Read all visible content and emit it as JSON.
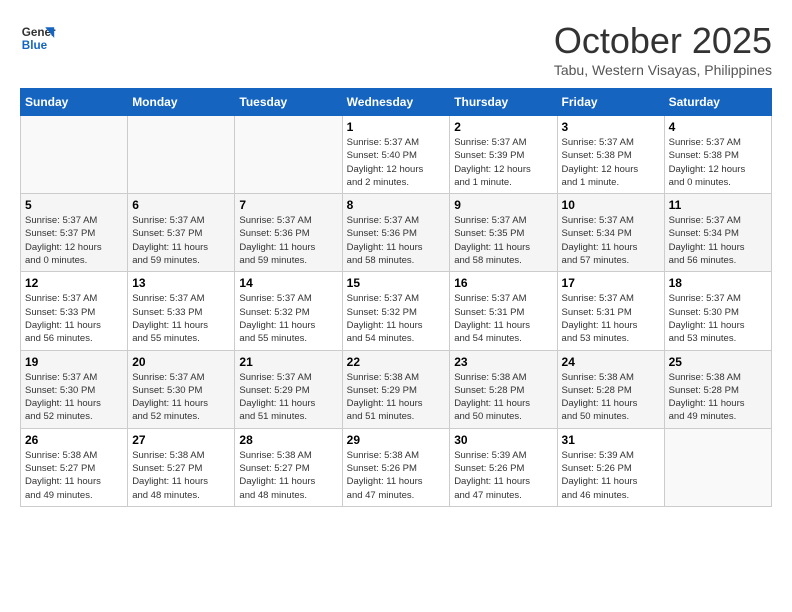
{
  "header": {
    "logo_line1": "General",
    "logo_line2": "Blue",
    "month": "October 2025",
    "location": "Tabu, Western Visayas, Philippines"
  },
  "days_of_week": [
    "Sunday",
    "Monday",
    "Tuesday",
    "Wednesday",
    "Thursday",
    "Friday",
    "Saturday"
  ],
  "weeks": [
    [
      {
        "day": "",
        "info": ""
      },
      {
        "day": "",
        "info": ""
      },
      {
        "day": "",
        "info": ""
      },
      {
        "day": "1",
        "info": "Sunrise: 5:37 AM\nSunset: 5:40 PM\nDaylight: 12 hours\nand 2 minutes."
      },
      {
        "day": "2",
        "info": "Sunrise: 5:37 AM\nSunset: 5:39 PM\nDaylight: 12 hours\nand 1 minute."
      },
      {
        "day": "3",
        "info": "Sunrise: 5:37 AM\nSunset: 5:38 PM\nDaylight: 12 hours\nand 1 minute."
      },
      {
        "day": "4",
        "info": "Sunrise: 5:37 AM\nSunset: 5:38 PM\nDaylight: 12 hours\nand 0 minutes."
      }
    ],
    [
      {
        "day": "5",
        "info": "Sunrise: 5:37 AM\nSunset: 5:37 PM\nDaylight: 12 hours\nand 0 minutes."
      },
      {
        "day": "6",
        "info": "Sunrise: 5:37 AM\nSunset: 5:37 PM\nDaylight: 11 hours\nand 59 minutes."
      },
      {
        "day": "7",
        "info": "Sunrise: 5:37 AM\nSunset: 5:36 PM\nDaylight: 11 hours\nand 59 minutes."
      },
      {
        "day": "8",
        "info": "Sunrise: 5:37 AM\nSunset: 5:36 PM\nDaylight: 11 hours\nand 58 minutes."
      },
      {
        "day": "9",
        "info": "Sunrise: 5:37 AM\nSunset: 5:35 PM\nDaylight: 11 hours\nand 58 minutes."
      },
      {
        "day": "10",
        "info": "Sunrise: 5:37 AM\nSunset: 5:34 PM\nDaylight: 11 hours\nand 57 minutes."
      },
      {
        "day": "11",
        "info": "Sunrise: 5:37 AM\nSunset: 5:34 PM\nDaylight: 11 hours\nand 56 minutes."
      }
    ],
    [
      {
        "day": "12",
        "info": "Sunrise: 5:37 AM\nSunset: 5:33 PM\nDaylight: 11 hours\nand 56 minutes."
      },
      {
        "day": "13",
        "info": "Sunrise: 5:37 AM\nSunset: 5:33 PM\nDaylight: 11 hours\nand 55 minutes."
      },
      {
        "day": "14",
        "info": "Sunrise: 5:37 AM\nSunset: 5:32 PM\nDaylight: 11 hours\nand 55 minutes."
      },
      {
        "day": "15",
        "info": "Sunrise: 5:37 AM\nSunset: 5:32 PM\nDaylight: 11 hours\nand 54 minutes."
      },
      {
        "day": "16",
        "info": "Sunrise: 5:37 AM\nSunset: 5:31 PM\nDaylight: 11 hours\nand 54 minutes."
      },
      {
        "day": "17",
        "info": "Sunrise: 5:37 AM\nSunset: 5:31 PM\nDaylight: 11 hours\nand 53 minutes."
      },
      {
        "day": "18",
        "info": "Sunrise: 5:37 AM\nSunset: 5:30 PM\nDaylight: 11 hours\nand 53 minutes."
      }
    ],
    [
      {
        "day": "19",
        "info": "Sunrise: 5:37 AM\nSunset: 5:30 PM\nDaylight: 11 hours\nand 52 minutes."
      },
      {
        "day": "20",
        "info": "Sunrise: 5:37 AM\nSunset: 5:30 PM\nDaylight: 11 hours\nand 52 minutes."
      },
      {
        "day": "21",
        "info": "Sunrise: 5:37 AM\nSunset: 5:29 PM\nDaylight: 11 hours\nand 51 minutes."
      },
      {
        "day": "22",
        "info": "Sunrise: 5:38 AM\nSunset: 5:29 PM\nDaylight: 11 hours\nand 51 minutes."
      },
      {
        "day": "23",
        "info": "Sunrise: 5:38 AM\nSunset: 5:28 PM\nDaylight: 11 hours\nand 50 minutes."
      },
      {
        "day": "24",
        "info": "Sunrise: 5:38 AM\nSunset: 5:28 PM\nDaylight: 11 hours\nand 50 minutes."
      },
      {
        "day": "25",
        "info": "Sunrise: 5:38 AM\nSunset: 5:28 PM\nDaylight: 11 hours\nand 49 minutes."
      }
    ],
    [
      {
        "day": "26",
        "info": "Sunrise: 5:38 AM\nSunset: 5:27 PM\nDaylight: 11 hours\nand 49 minutes."
      },
      {
        "day": "27",
        "info": "Sunrise: 5:38 AM\nSunset: 5:27 PM\nDaylight: 11 hours\nand 48 minutes."
      },
      {
        "day": "28",
        "info": "Sunrise: 5:38 AM\nSunset: 5:27 PM\nDaylight: 11 hours\nand 48 minutes."
      },
      {
        "day": "29",
        "info": "Sunrise: 5:38 AM\nSunset: 5:26 PM\nDaylight: 11 hours\nand 47 minutes."
      },
      {
        "day": "30",
        "info": "Sunrise: 5:39 AM\nSunset: 5:26 PM\nDaylight: 11 hours\nand 47 minutes."
      },
      {
        "day": "31",
        "info": "Sunrise: 5:39 AM\nSunset: 5:26 PM\nDaylight: 11 hours\nand 46 minutes."
      },
      {
        "day": "",
        "info": ""
      }
    ]
  ]
}
